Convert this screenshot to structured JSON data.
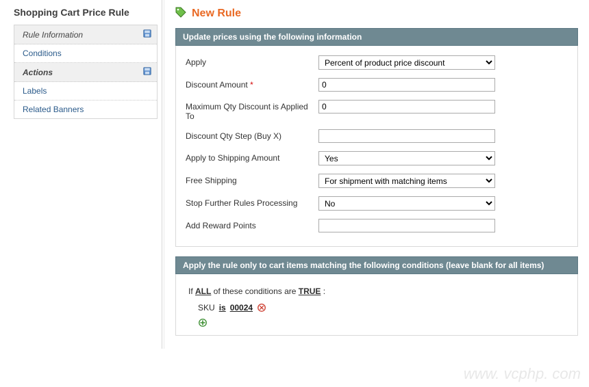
{
  "sidebar": {
    "title": "Shopping Cart Price Rule",
    "items": [
      {
        "label": "Rule Information",
        "icon": true,
        "cls": "info"
      },
      {
        "label": "Conditions",
        "icon": false,
        "cls": ""
      },
      {
        "label": "Actions",
        "icon": true,
        "cls": "active"
      },
      {
        "label": "Labels",
        "icon": false,
        "cls": ""
      },
      {
        "label": "Related Banners",
        "icon": false,
        "cls": ""
      }
    ]
  },
  "page": {
    "title": "New Rule"
  },
  "section1": {
    "legend": "Update prices using the following information",
    "apply": {
      "label": "Apply",
      "value": "Percent of product price discount"
    },
    "discount_amount": {
      "label": "Discount Amount",
      "required": "*",
      "value": "0"
    },
    "max_qty": {
      "label": "Maximum Qty Discount is Applied To",
      "value": "0"
    },
    "qty_step": {
      "label": "Discount Qty Step (Buy X)",
      "value": ""
    },
    "apply_shipping": {
      "label": "Apply to Shipping Amount",
      "value": "Yes"
    },
    "free_shipping": {
      "label": "Free Shipping",
      "value": "For shipment with matching items"
    },
    "stop_rules": {
      "label": "Stop Further Rules Processing",
      "value": "No"
    },
    "reward_points": {
      "label": "Add Reward Points",
      "value": ""
    }
  },
  "section2": {
    "legend": "Apply the rule only to cart items matching the following conditions (leave blank for all items)",
    "line": {
      "prefix": "If ",
      "aggregator": "ALL",
      "middle": "  of these conditions are ",
      "value": "TRUE",
      "suffix": " :"
    },
    "cond": {
      "attr": "SKU",
      "op": "is",
      "val": "00024"
    }
  },
  "watermark": "www. vcphp. com"
}
